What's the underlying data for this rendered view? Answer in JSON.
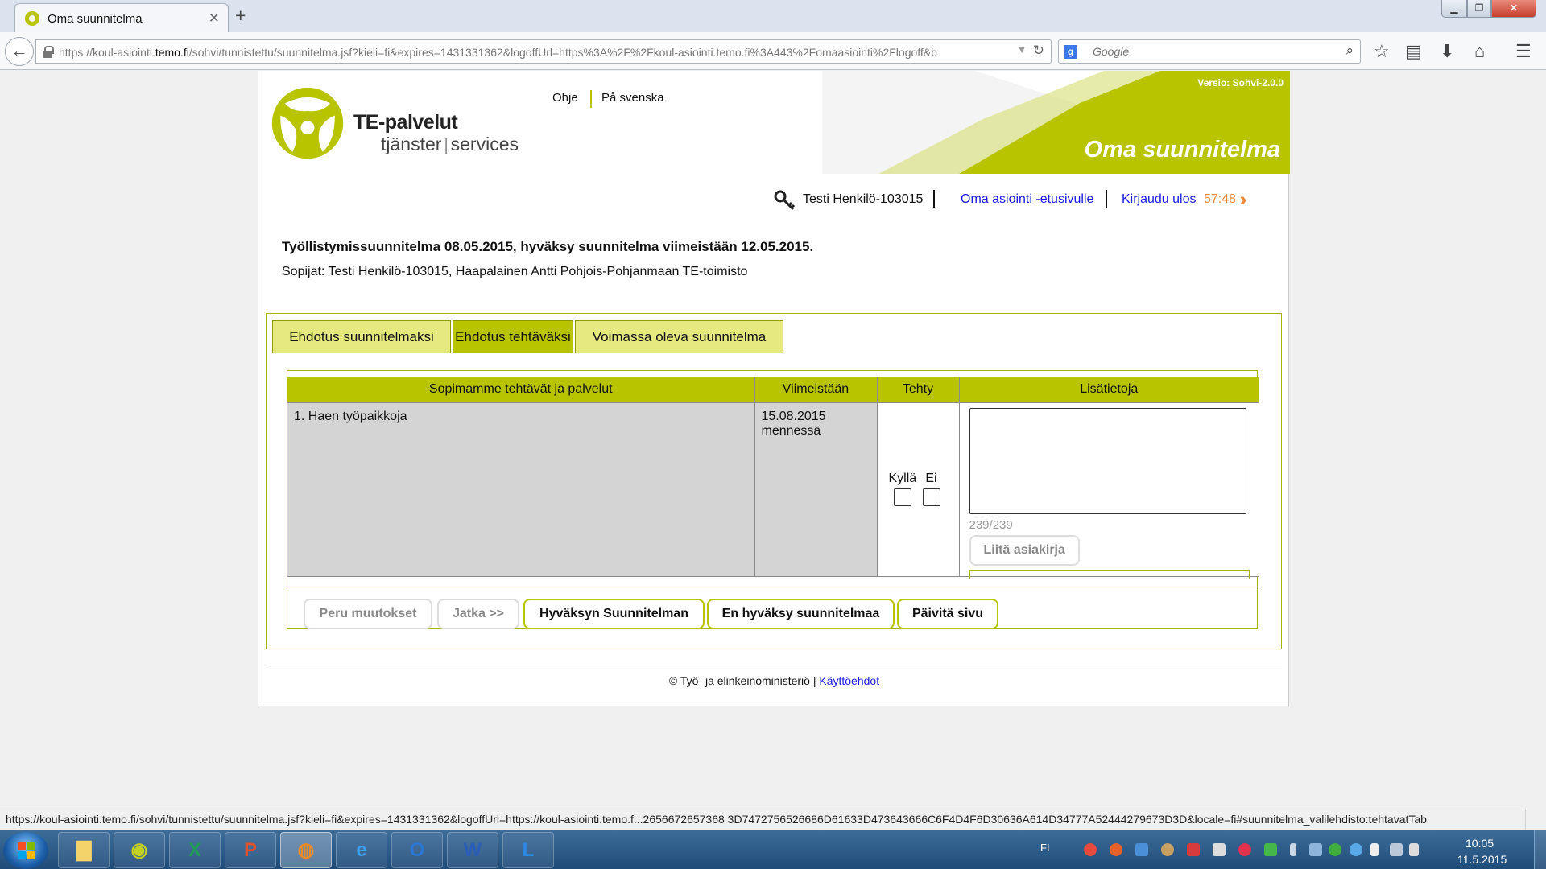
{
  "browser": {
    "tab_title": "Oma suunnitelma",
    "tab_close": "✕",
    "new_tab": "+",
    "url_prefix": "https://koul-asiointi.",
    "url_domain": "temo.fi",
    "url_rest": "/sohvi/tunnistettu/suunnitelma.jsf?kieli=fi&expires=1431331362&logoffUrl=https%3A%2F%2Fkoul-asiointi.temo.fi%3A443%2Fomaasiointi%2Flogoff&b",
    "search_placeholder": "Google",
    "status_url": "https://koul-asiointi.temo.fi/sohvi/tunnistettu/suunnitelma.jsf?kieli=fi&expires=1431331362&logoffUrl=https://koul-asiointi.temo.f...2656672657368 3D7472756526686D61633D473643666C6F4D4F6D30636A614D34777A52444279673D3D&locale=fi#suunnitelma_valilehdisto:tehtavatTab"
  },
  "header": {
    "brand_main": "TE-palvelut",
    "brand_sub_left": "tjänster",
    "brand_sub_sep": "|",
    "brand_sub_right": "services",
    "link_help": "Ohje",
    "link_swedish": "På svenska",
    "version": "Versio: Sohvi-2.0.0",
    "page_heading": "Oma suunnitelma",
    "accent_color": "#b8c400"
  },
  "userbar": {
    "user_name": "Testi Henkilö-103015",
    "link_home": "Oma asiointi -etusivulle",
    "link_logout": "Kirjaudu ulos",
    "logout_timer": "57:48"
  },
  "plan": {
    "title": "Työllistymissuunnitelma 08.05.2015, hyväksy suunnitelma viimeistään 12.05.2015.",
    "parties": "Sopijat: Testi Henkilö-103015, Haapalainen Antti Pohjois-Pohjanmaan TE-toimisto"
  },
  "tabs": [
    {
      "label": "Ehdotus suunnitelmaksi"
    },
    {
      "label": "Ehdotus tehtäväksi"
    },
    {
      "label": "Voimassa oleva suunnitelma"
    }
  ],
  "table": {
    "headers": [
      "Sopimamme tehtävät ja palvelut",
      "Viimeistään",
      "Tehty",
      "Lisätietoja"
    ],
    "rows": [
      {
        "task": "1. Haen työpaikkoja",
        "deadline_date": "15.08.2015",
        "deadline_suffix": "mennessä",
        "yes_label": "Kyllä",
        "no_label": "Ei",
        "char_counter": "239/239",
        "attach_label": "Liitä asiakirja"
      }
    ]
  },
  "buttons": {
    "cancel": "Peru muutokset",
    "continue": "Jatka >>",
    "accept": "Hyväksyn Suunnitelman",
    "reject": "En hyväksy suunnitelmaa",
    "refresh": "Päivitä sivu"
  },
  "footer": {
    "copyright": "© Työ- ja elinkeinoministeriö",
    "sep": "|",
    "terms": "Käyttöehdot"
  },
  "taskbar": {
    "lang": "FI",
    "time": "10:05",
    "date": "11.5.2015"
  }
}
